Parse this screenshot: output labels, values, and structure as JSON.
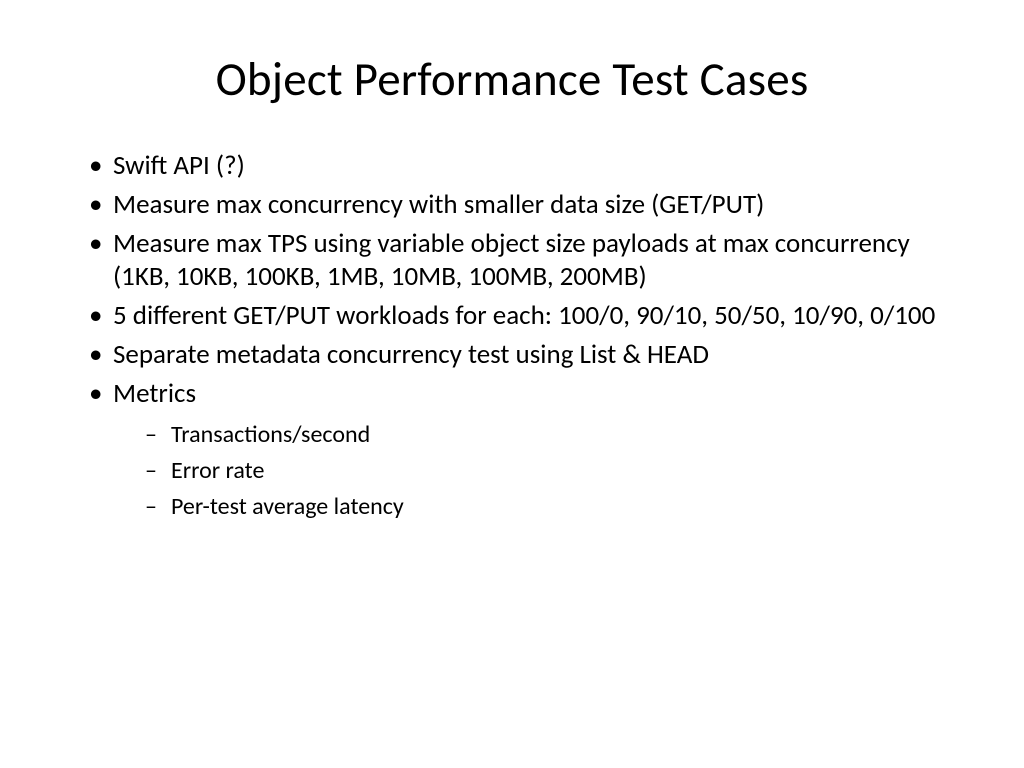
{
  "title": "Object Performance Test Cases",
  "bullets": [
    "Swift API (?)",
    "Measure max concurrency with smaller data size (GET/PUT)",
    "Measure max TPS using variable object size payloads at max concurrency (1KB, 10KB, 100KB, 1MB, 10MB, 100MB, 200MB)",
    "5 different GET/PUT workloads for each: 100/0, 90/10, 50/50, 10/90, 0/100",
    "Separate metadata concurrency test using List & HEAD",
    "Metrics"
  ],
  "sub_bullets": [
    "Transactions/second",
    "Error rate",
    "Per-test average latency"
  ]
}
